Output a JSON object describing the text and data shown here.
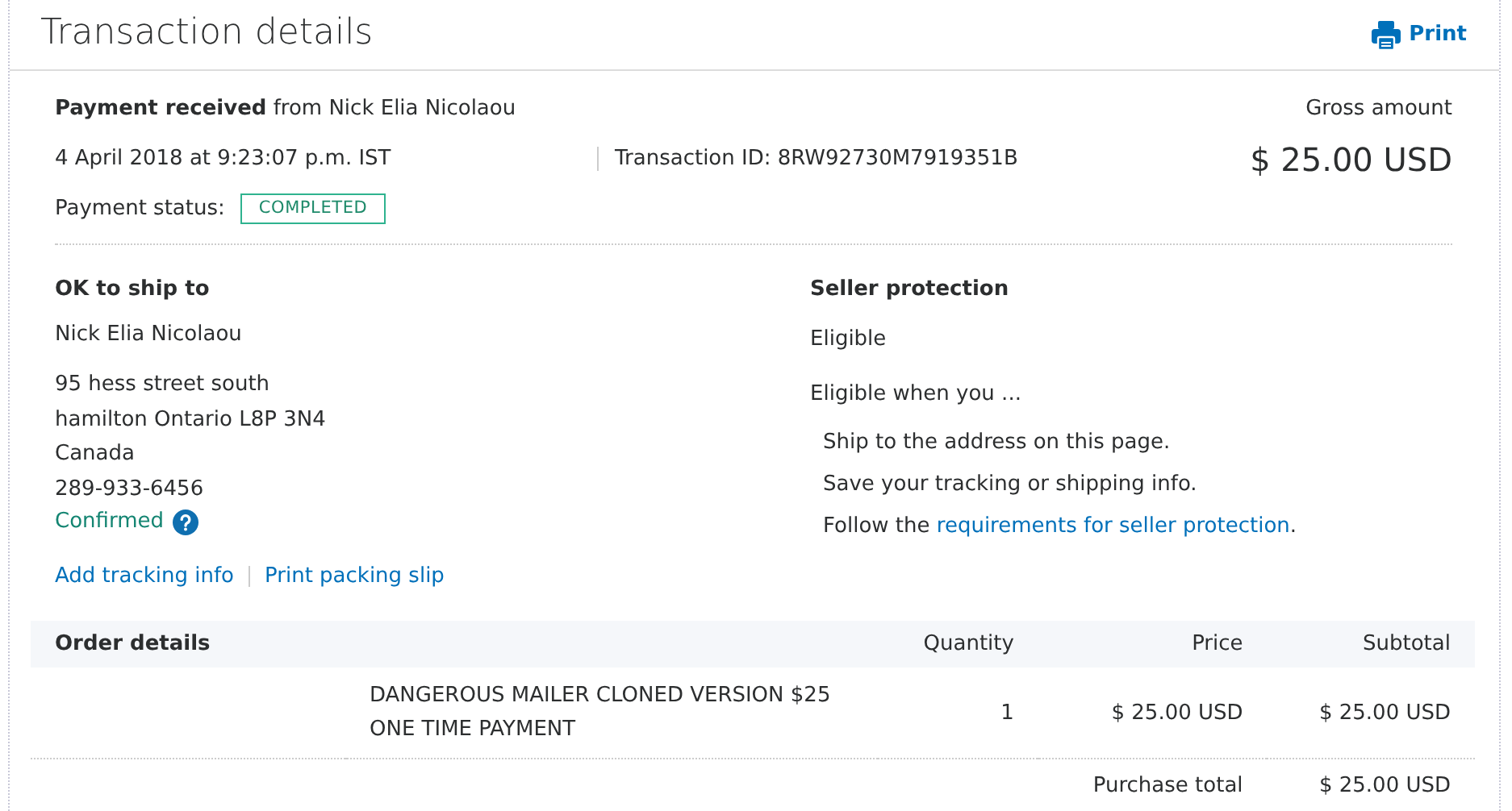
{
  "header": {
    "title": "Transaction details",
    "print_label": "Print"
  },
  "summary": {
    "headline": "**Payment received** from Nick Elia Nicolaou",
    "date": "4 April 2018 at 9:23:07 p.m. IST",
    "transaction_id": "Transaction ID: 8RW92730M7919351B",
    "status_label": "Payment status:",
    "status": "COMPLETED",
    "gross_label": "Gross amount",
    "gross_amount": "$ 25.00 USD"
  },
  "shipping": {
    "heading": "OK to ship to",
    "name": "Nick Elia Nicolaou",
    "address_lines": [
      "95 hess street south",
      "hamilton Ontario L8P 3N4",
      "Canada",
      "289-933-6456"
    ],
    "confirmed": "Confirmed",
    "links": [
      "Add tracking info",
      "Print packing slip"
    ]
  },
  "seller_protection": {
    "heading": "Seller protection",
    "status": "Eligible",
    "intro": "Eligible when you ...",
    "steps": [
      {
        "text": "Ship to the address on this page."
      },
      {
        "text": "Save your tracking or shipping info."
      },
      {
        "text": "Follow the ",
        "link": "requirements for seller protection",
        "suffix": "."
      }
    ]
  },
  "order": {
    "columns": [
      "Order details",
      "Quantity",
      "Price",
      "Subtotal"
    ],
    "rows": [
      {
        "description": "DANGEROUS MAILER CLONED VERSION $25 ONE TIME PAYMENT",
        "quantity": "1",
        "price": "$ 25.00 USD",
        "subtotal": "$ 25.00 USD"
      }
    ],
    "total_label": "Purchase total",
    "total": "$ 25.00 USD"
  }
}
